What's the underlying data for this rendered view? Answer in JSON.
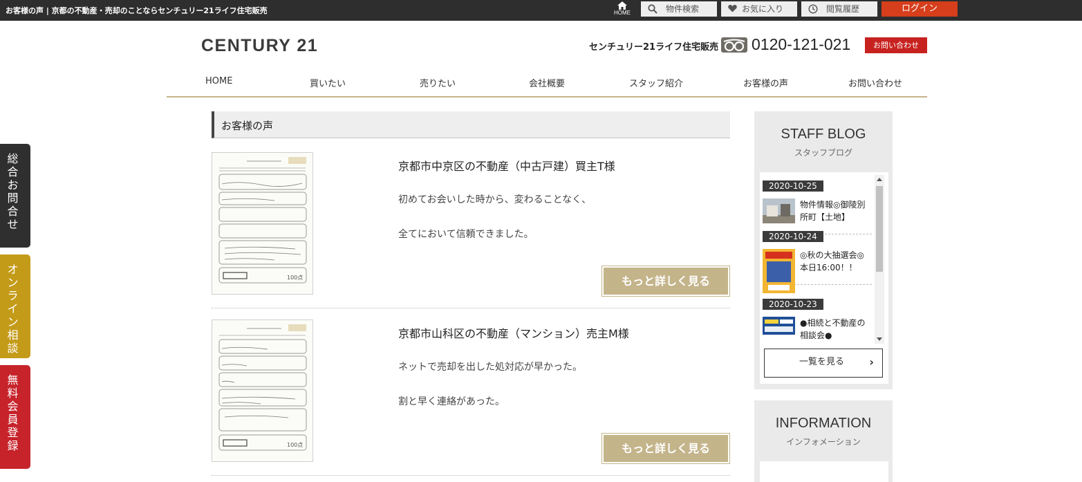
{
  "topbar": {
    "site_title": "お客様の声 | 京都の不動産・売却のことならセンチュリー21ライフ住宅販売",
    "home_label": "HOME",
    "search_label": "物件検索",
    "favorites_label": "お気に入り",
    "history_label": "閲覧履歴",
    "login_label": "ログイン"
  },
  "header": {
    "logo": "CENTURY 21",
    "company": "センチュリー21ライフ住宅販売",
    "phone": "0120-121-021",
    "contact_button": "お問い合わせ"
  },
  "nav": {
    "items": [
      "HOME",
      "買いたい",
      "売りたい",
      "会社概要",
      "スタッフ紹介",
      "お客様の声",
      "お問い合わせ"
    ]
  },
  "side_tabs": {
    "contact": "総合お問合せ",
    "online": "オンライン相談",
    "member": "無料会員登録"
  },
  "main": {
    "section_title": "お客様の声",
    "voices": [
      {
        "title": "京都市中京区の不動産（中古戸建）買主T様",
        "lines": [
          "初めてお会いした時から、変わることなく、",
          "全てにおいて信頼できました。"
        ],
        "button": "もっと詳しく見る"
      },
      {
        "title": "京都市山科区の不動産（マンション）売主M様",
        "lines": [
          "ネットで売却を出した処対応が早かった。",
          "割と早く連絡があった。"
        ],
        "button": "もっと詳しく見る"
      }
    ]
  },
  "sidebar": {
    "blog": {
      "title": "STAFF BLOG",
      "subtitle": "スタッフブログ",
      "items": [
        {
          "date": "2020-10-25",
          "text": "物件情報◎御陵別所町【土地】"
        },
        {
          "date": "2020-10-24",
          "text": "◎秋の大抽選会◎本日16:00！！"
        },
        {
          "date": "2020-10-23",
          "text": "●相続と不動産の相談会●"
        }
      ],
      "more": "一覧を見る",
      "more_arrow": "›"
    },
    "info": {
      "title": "INFORMATION",
      "subtitle": "インフォメーション"
    }
  },
  "colors": {
    "topbar": "#2e2e2e",
    "login": "#d63e1c",
    "gold": "#c4b48a",
    "contact_red": "#c7221f",
    "tab_dark": "#2f2f2f",
    "tab_gold": "#c49b19",
    "tab_red": "#c7232b"
  }
}
